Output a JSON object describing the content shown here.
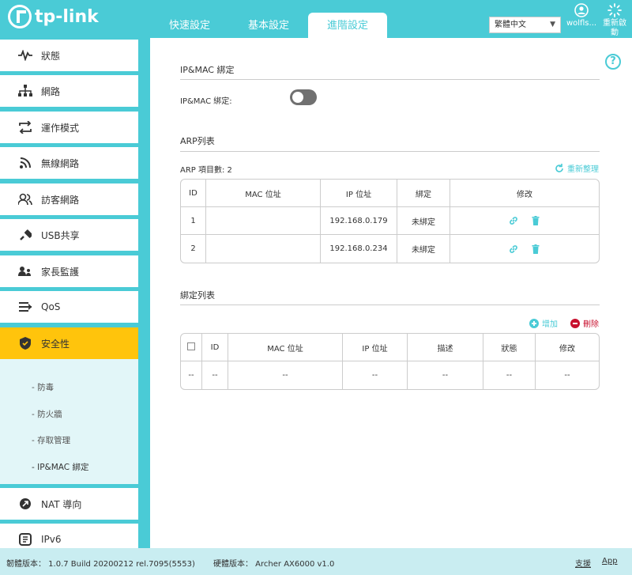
{
  "header": {
    "logo_text": "tp-link",
    "tabs": [
      {
        "label": "快速設定"
      },
      {
        "label": "基本設定"
      },
      {
        "label": "進階設定"
      }
    ],
    "language": "繁體中文",
    "user_label": "wolfls...",
    "reboot_label_1": "重新啟",
    "reboot_label_2": "動"
  },
  "sidebar": {
    "items": [
      {
        "label": "狀態",
        "icon": "pulse-icon"
      },
      {
        "label": "網路",
        "icon": "network-icon"
      },
      {
        "label": "運作模式",
        "icon": "mode-icon"
      },
      {
        "label": "無線網路",
        "icon": "wifi-icon"
      },
      {
        "label": "訪客網路",
        "icon": "guest-icon"
      },
      {
        "label": "USB共享",
        "icon": "usb-icon"
      },
      {
        "label": "家長監護",
        "icon": "parental-icon"
      },
      {
        "label": "QoS",
        "icon": "qos-icon"
      },
      {
        "label": "安全性",
        "icon": "shield-icon"
      },
      {
        "label": "NAT 導向",
        "icon": "nat-icon"
      },
      {
        "label": "IPv6",
        "icon": "ipv6-icon"
      }
    ],
    "sub_items": [
      {
        "label": "- 防毒"
      },
      {
        "label": "- 防火牆"
      },
      {
        "label": "- 存取管理"
      },
      {
        "label": "- IP&MAC 綁定"
      }
    ]
  },
  "main": {
    "ipmac_section_title": "IP&MAC 綁定",
    "ipmac_toggle_label": "IP&MAC 綁定:",
    "ipmac_enabled": false,
    "arp_section_title": "ARP列表",
    "arp_count_label": "ARP 項目數: 2",
    "refresh_label": "重新整理",
    "arp_headers": [
      "ID",
      "MAC 位址",
      "IP 位址",
      "綁定",
      "修改"
    ],
    "arp_rows": [
      {
        "id": "1",
        "mac": "",
        "ip": "192.168.0.179",
        "bound": "未綁定"
      },
      {
        "id": "2",
        "mac": "",
        "ip": "192.168.0.234",
        "bound": "未綁定"
      }
    ],
    "bind_section_title": "綁定列表",
    "add_label": "增加",
    "delete_label": "刪除",
    "bind_headers": [
      "ID",
      "MAC 位址",
      "IP 位址",
      "描述",
      "狀態",
      "修改"
    ],
    "bind_row": [
      "--",
      "--",
      "--",
      "--",
      "--",
      "--",
      "--"
    ]
  },
  "footer": {
    "firmware": "韌體版本： 1.0.7 Build 20200212 rel.7095(5553)",
    "hardware": "硬體版本： Archer AX6000 v1.0",
    "support": "支援",
    "app": "App"
  },
  "colors": {
    "brand": "#4acbd6",
    "active_nav": "#ffc40c",
    "delete": "#c8102e"
  }
}
